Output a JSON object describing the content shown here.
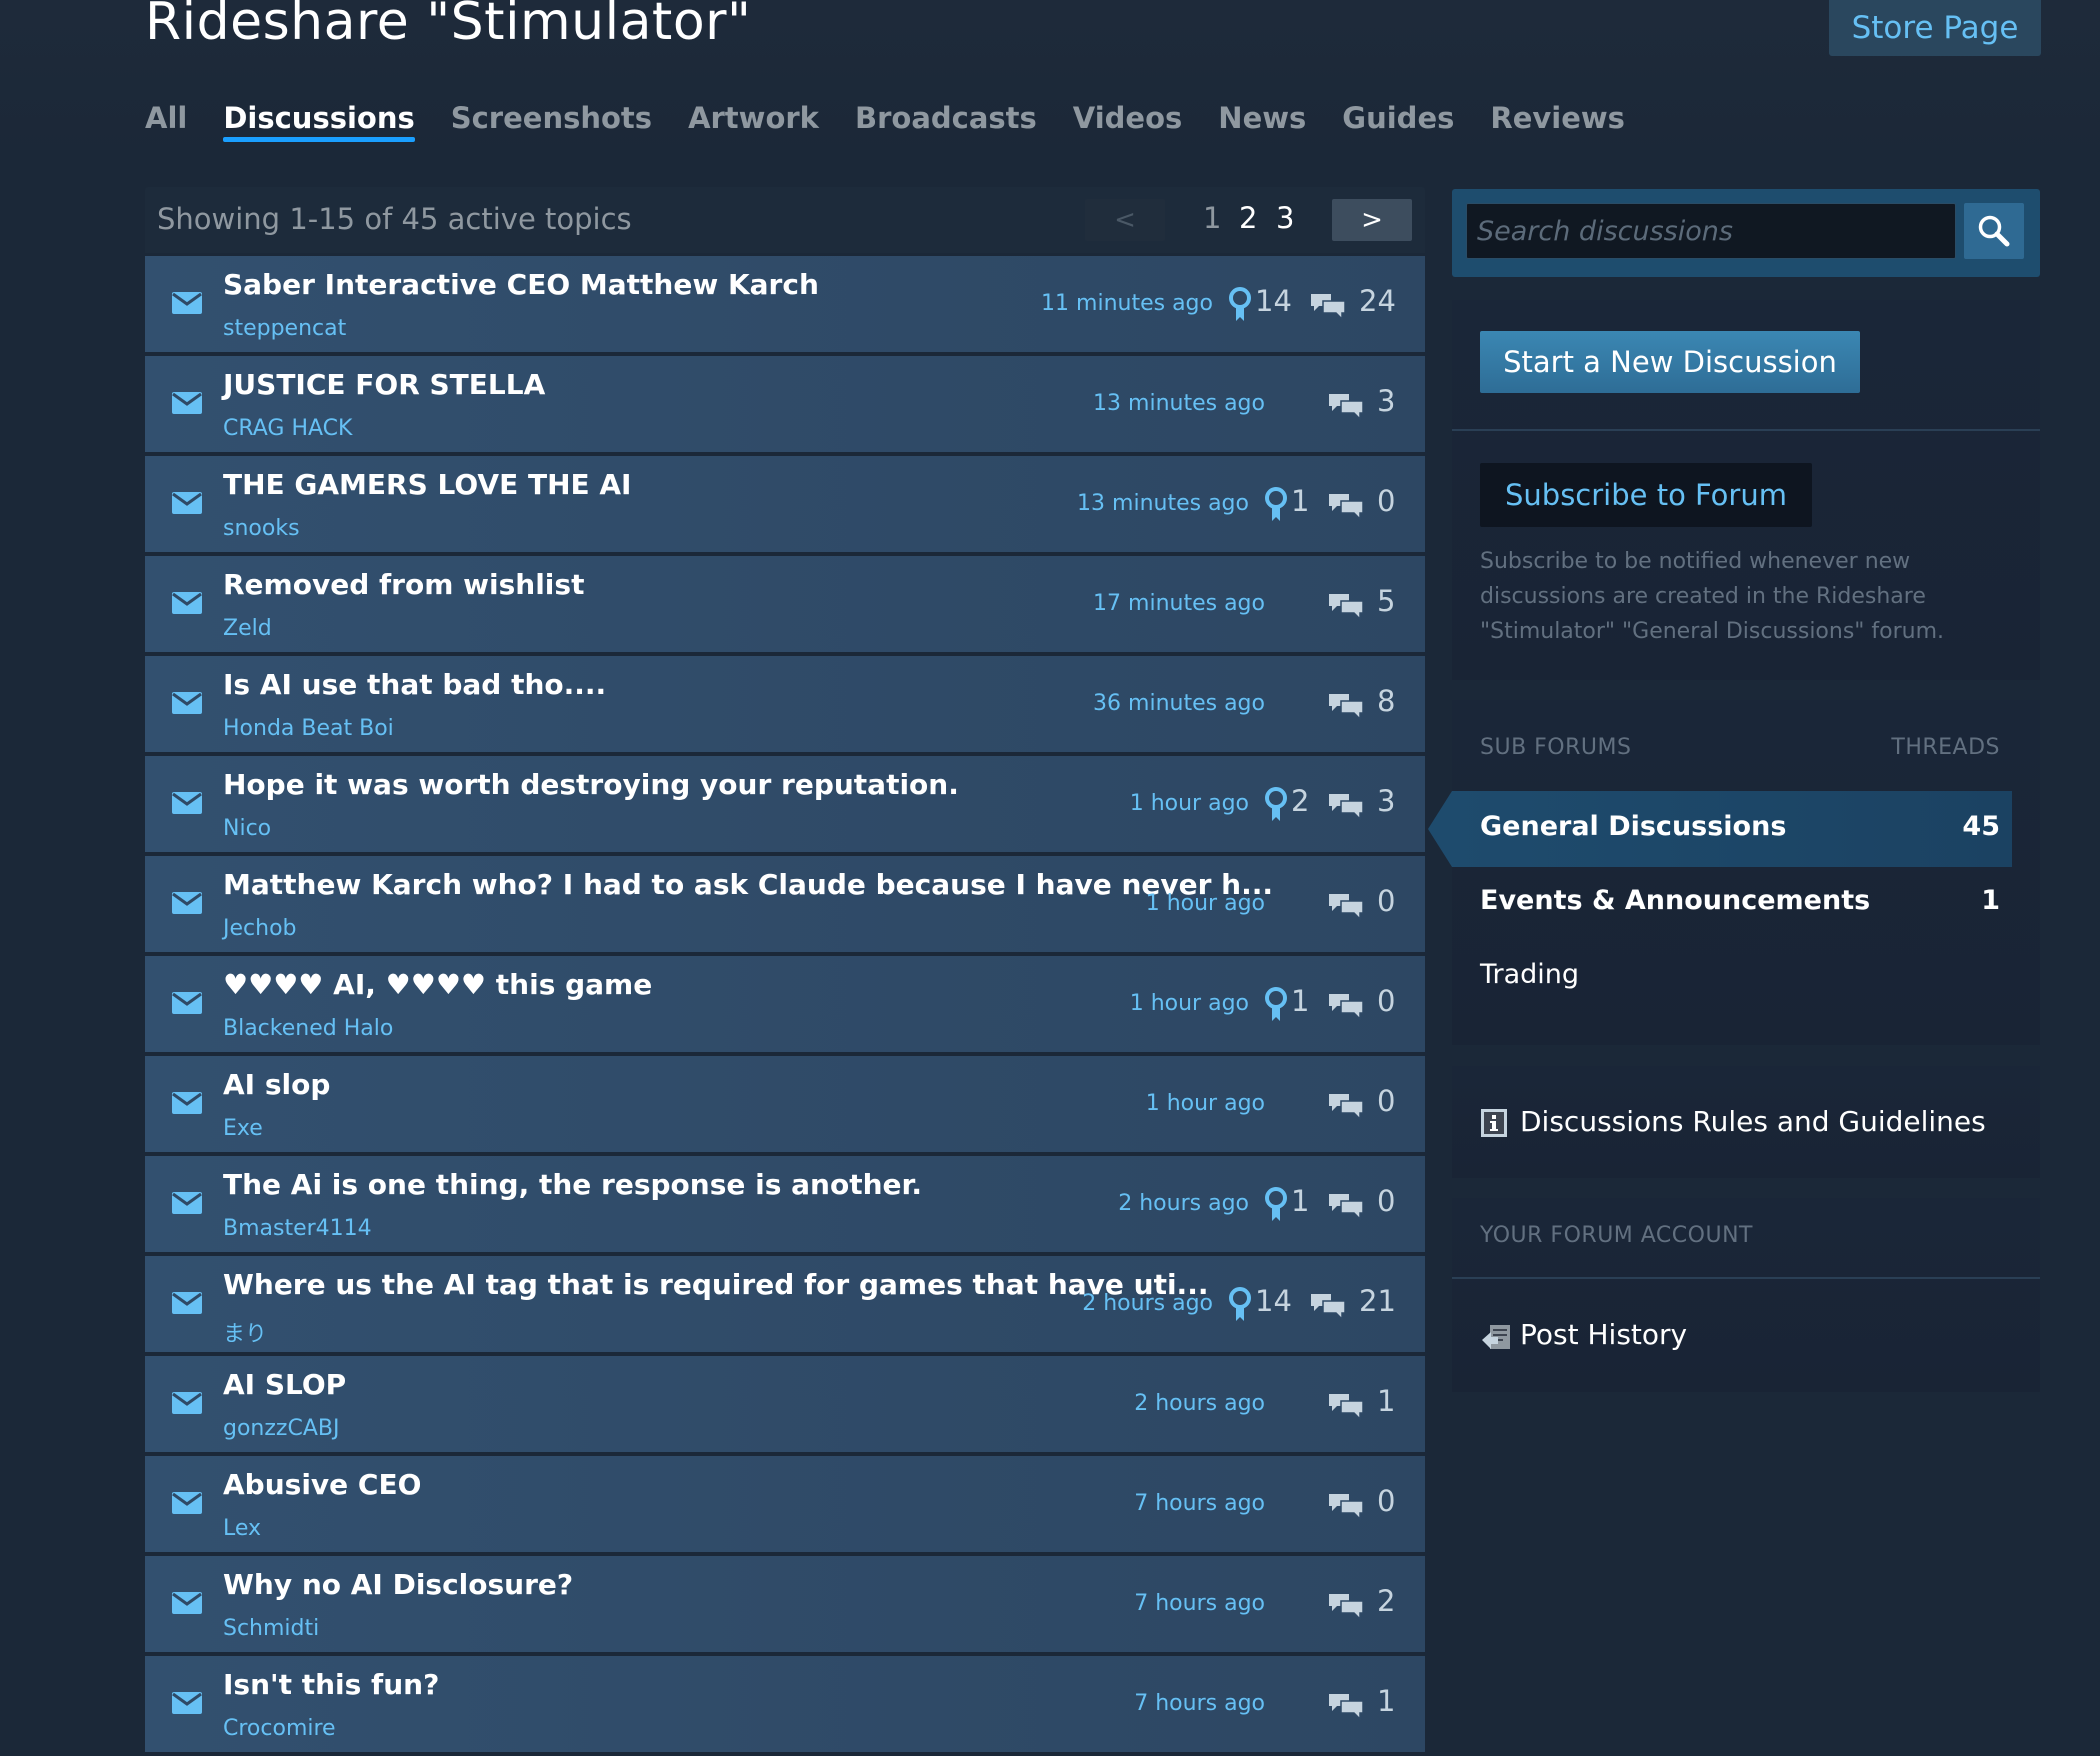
{
  "header": {
    "title": "Rideshare \"Stimulator\"",
    "store_button": "Store Page"
  },
  "tabs": [
    {
      "label": "All",
      "active": false
    },
    {
      "label": "Discussions",
      "active": true
    },
    {
      "label": "Screenshots",
      "active": false
    },
    {
      "label": "Artwork",
      "active": false
    },
    {
      "label": "Broadcasts",
      "active": false
    },
    {
      "label": "Videos",
      "active": false
    },
    {
      "label": "News",
      "active": false
    },
    {
      "label": "Guides",
      "active": false
    },
    {
      "label": "Reviews",
      "active": false
    }
  ],
  "list": {
    "showing_text": "Showing 1-15 of 45 active topics",
    "pagination": {
      "prev": "<",
      "next": ">",
      "pages": [
        "1",
        "2",
        "3"
      ],
      "current": "1"
    }
  },
  "topics": [
    {
      "title": "Saber Interactive CEO Matthew Karch",
      "author": "steppencat",
      "time": "11 minutes ago",
      "awards": "14",
      "replies": "24"
    },
    {
      "title": "JUSTICE FOR STELLA",
      "author": "CRAG HACK",
      "time": "13 minutes ago",
      "awards": null,
      "replies": "3"
    },
    {
      "title": "THE GAMERS LOVE THE AI",
      "author": "snooks",
      "time": "13 minutes ago",
      "awards": "1",
      "replies": "0"
    },
    {
      "title": "Removed from wishlist",
      "author": "Zeld",
      "time": "17 minutes ago",
      "awards": null,
      "replies": "5"
    },
    {
      "title": "Is AI use that bad tho....",
      "author": "Honda Beat Boi",
      "time": "36 minutes ago",
      "awards": null,
      "replies": "8"
    },
    {
      "title": "Hope it was worth destroying your reputation.",
      "author": "Nico",
      "time": "1 hour ago",
      "awards": "2",
      "replies": "3"
    },
    {
      "title": "Matthew Karch who? I had to ask Claude because I have never h...",
      "author": "Jechob",
      "time": "1 hour ago",
      "awards": null,
      "replies": "0"
    },
    {
      "title": "♥♥♥♥ AI, ♥♥♥♥ this game",
      "author": "Blackened Halo",
      "time": "1 hour ago",
      "awards": "1",
      "replies": "0"
    },
    {
      "title": "AI slop",
      "author": "Exe",
      "time": "1 hour ago",
      "awards": null,
      "replies": "0"
    },
    {
      "title": "The Ai is one thing, the response is another.",
      "author": "Bmaster4114",
      "time": "2 hours ago",
      "awards": "1",
      "replies": "0"
    },
    {
      "title": "Where us the AI tag that is required for games that have uti...",
      "author": "まり",
      "time": "2 hours ago",
      "awards": "14",
      "replies": "21"
    },
    {
      "title": "AI SLOP",
      "author": "gonzzCABJ",
      "time": "2 hours ago",
      "awards": null,
      "replies": "1"
    },
    {
      "title": "Abusive CEO",
      "author": "Lex",
      "time": "7 hours ago",
      "awards": null,
      "replies": "0"
    },
    {
      "title": "Why no AI Disclosure?",
      "author": "Schmidti",
      "time": "7 hours ago",
      "awards": null,
      "replies": "2"
    },
    {
      "title": "Isn't this fun?",
      "author": "Crocomire",
      "time": "7 hours ago",
      "awards": null,
      "replies": "1"
    }
  ],
  "sidebar": {
    "search_placeholder": "Search discussions",
    "start_button": "Start a New Discussion",
    "subscribe_button": "Subscribe to Forum",
    "subscribe_desc": "Subscribe to be notified whenever new discussions are created in the Rideshare \"Stimulator\" \"General Discussions\" forum.",
    "subforums": {
      "header": "SUB FORUMS",
      "threads_header": "THREADS",
      "items": [
        {
          "name": "General Discussions",
          "count": "45",
          "active": true
        },
        {
          "name": "Events & Announcements",
          "count": "1",
          "active": false
        },
        {
          "name": "Trading",
          "count": null,
          "active": false
        }
      ]
    },
    "rules_label": "Discussions Rules and Guidelines",
    "account_header": "YOUR FORUM ACCOUNT",
    "post_history": "Post History"
  },
  "colors": {
    "background": "#1b2838",
    "accent": "#66c0f4",
    "tab_underline": "#1a9fff",
    "topic_row": "#32506f",
    "button_blue": "#3b87b3"
  },
  "icons": {
    "topic_unread": "envelope-icon",
    "award": "award-ribbon-icon",
    "replies": "speech-bubbles-icon",
    "search": "magnifier-icon",
    "rules": "info-icon",
    "post_history": "post-history-icon"
  }
}
